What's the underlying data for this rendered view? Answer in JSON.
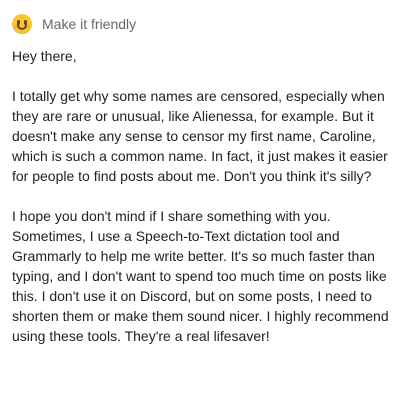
{
  "header": {
    "icon": "smiling-face-icon",
    "title": "Make it friendly"
  },
  "message": {
    "greeting": "Hey there,",
    "paragraphs": [
      "I totally get why some names are censored, especially when they are rare or unusual, like Alienessa, for example. But it doesn't make any sense to censor my first name, Caroline, which is such a common name. In fact, it just makes it easier for people to find posts about me. Don't you think it's silly?",
      "I hope you don't mind if I share something with you. Sometimes, I use a Speech-to-Text dictation tool and Grammarly to help me write better. It's so much faster than typing, and I don't want to spend too much time on posts like this. I don't use it on Discord, but on some posts, I need to shorten them or make them sound nicer. I highly recommend using these tools. They're a real lifesaver!"
    ]
  }
}
